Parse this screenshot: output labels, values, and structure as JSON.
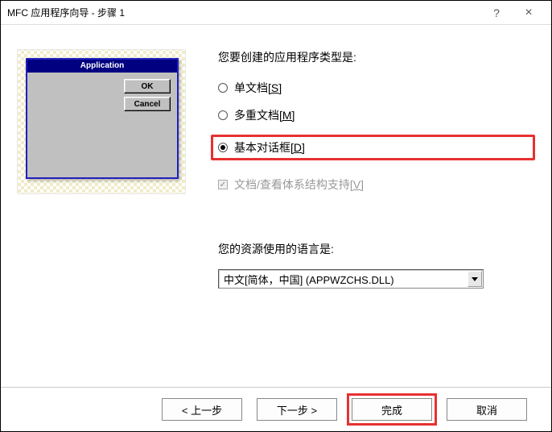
{
  "titlebar": {
    "title": "MFC 应用程序向导 - 步骤 1"
  },
  "preview": {
    "app_title": "Application",
    "ok_label": "OK",
    "cancel_label": "Cancel"
  },
  "questions": {
    "type_prompt": "您要创建的应用程序类型是:",
    "lang_prompt": "您的资源使用的语言是:"
  },
  "radios": {
    "single_doc": {
      "label": "单文档",
      "accel": "[S]"
    },
    "multi_doc": {
      "label": "多重文档",
      "accel": "[M]"
    },
    "dialog": {
      "label": "基本对话框",
      "accel": "[D]"
    }
  },
  "checkbox": {
    "docview": {
      "label": "文档/查看体系结构支持",
      "accel": "[V]"
    }
  },
  "dropdown": {
    "selected": "中文[简体，中国] (APPWZCHS.DLL)"
  },
  "buttons": {
    "back": "< 上一步",
    "next": "下一步 >",
    "finish": "完成",
    "cancel": "取消"
  }
}
